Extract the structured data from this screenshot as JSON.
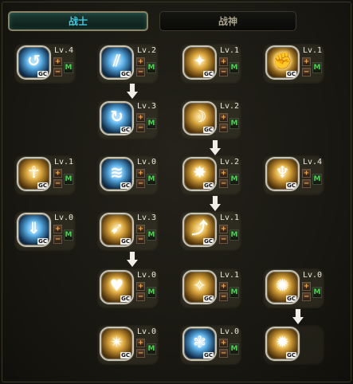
{
  "tabs": [
    {
      "label": "战士",
      "active": true
    },
    {
      "label": "战神",
      "active": false
    }
  ],
  "labels": {
    "gc": "GC",
    "plus": "+",
    "minus": "−",
    "m": "M"
  },
  "skills": [
    {
      "level": "Lv.4",
      "theme": "blue",
      "icon": "swirl-icon",
      "glyph": "↺"
    },
    {
      "level": "Lv.2",
      "theme": "blue",
      "icon": "slash-icon",
      "glyph": "⫽"
    },
    {
      "level": "Lv.1",
      "theme": "gold",
      "icon": "rune-circle-icon",
      "glyph": "✦"
    },
    {
      "level": "Lv.1",
      "theme": "gold",
      "icon": "fist-icon",
      "glyph": "✊"
    },
    {
      "level": "Lv.3",
      "theme": "blue",
      "icon": "spin-slash-icon",
      "glyph": "↻"
    },
    {
      "level": "Lv.2",
      "theme": "gold",
      "icon": "crescent-icon",
      "glyph": "☽"
    },
    {
      "level": "Lv.1",
      "theme": "gold",
      "icon": "ankh-icon",
      "glyph": "☥"
    },
    {
      "level": "Lv.0",
      "theme": "blue",
      "icon": "wing-slash-icon",
      "glyph": "≋"
    },
    {
      "level": "Lv.2",
      "theme": "gold",
      "icon": "burst-icon",
      "glyph": "✸"
    },
    {
      "level": "Lv.4",
      "theme": "gold",
      "icon": "flame-icon",
      "glyph": "♆"
    },
    {
      "level": "Lv.0",
      "theme": "blue",
      "icon": "ground-strike-icon",
      "glyph": "⇓"
    },
    {
      "level": "Lv.3",
      "theme": "gold",
      "icon": "dash-icon",
      "glyph": "➹"
    },
    {
      "level": "Lv.1",
      "theme": "gold",
      "icon": "lunge-icon",
      "glyph": "⤴"
    },
    {
      "level": "Lv.0",
      "theme": "gold",
      "icon": "heart-icon",
      "glyph": "♥"
    },
    {
      "level": "Lv.1",
      "theme": "gold",
      "icon": "claw-icon",
      "glyph": "✧"
    },
    {
      "level": "Lv.0",
      "theme": "gold",
      "icon": "explosion-icon",
      "glyph": "✺"
    },
    {
      "level": "Lv.0",
      "theme": "gold",
      "icon": "mp-fist-icon",
      "glyph": "✴"
    },
    {
      "level": "Lv.0",
      "theme": "blue",
      "icon": "paw-icon",
      "glyph": "❃"
    },
    {
      "level": "",
      "theme": "gold",
      "icon": "mp-burst-icon",
      "glyph": "✹"
    }
  ]
}
